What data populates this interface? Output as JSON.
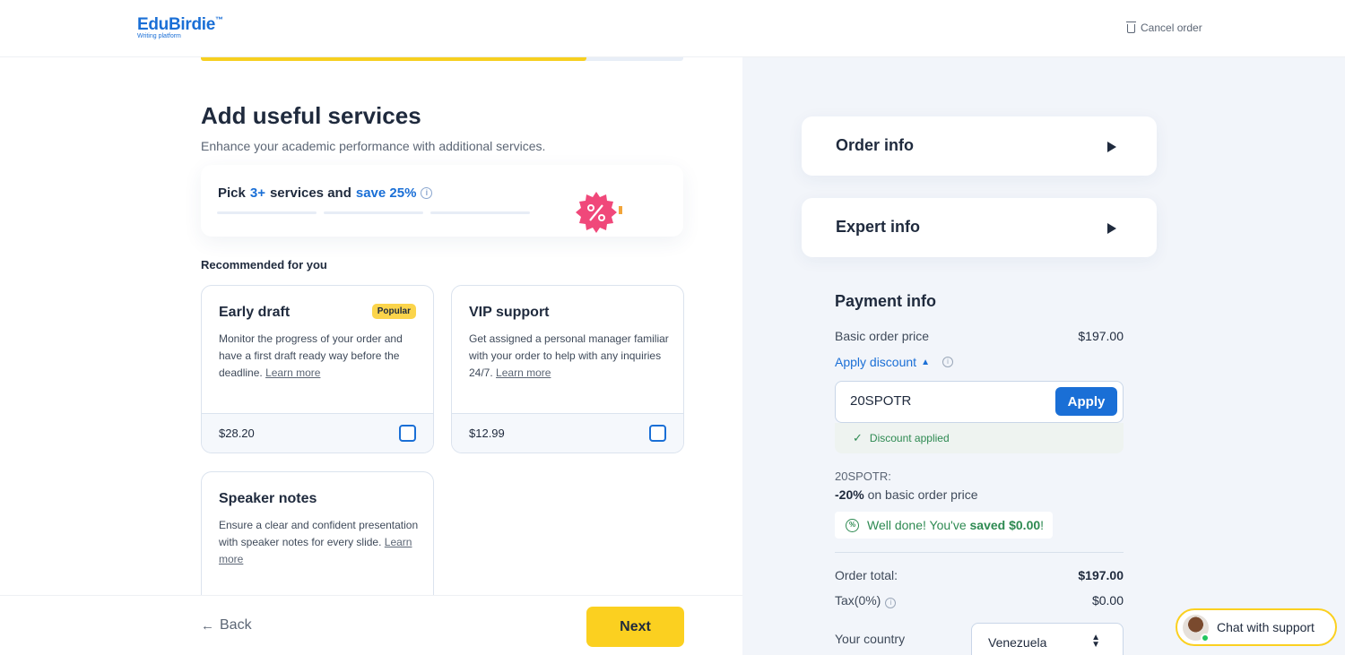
{
  "header": {
    "logo_name": "EduBirdie",
    "logo_tm": "™",
    "logo_tagline": "Writing platform",
    "cancel_label": "Cancel order"
  },
  "progress": {
    "fraction": 0.8
  },
  "main": {
    "title": "Add useful services",
    "subtitle": "Enhance your academic performance with additional services.",
    "promo": {
      "pick": "Pick",
      "count": "3+",
      "services": "services and",
      "save": "save 25%",
      "info_icon": "i"
    },
    "recommended": "Recommended for you",
    "cards": [
      {
        "title": "Early draft",
        "badge": "Popular",
        "desc": "Monitor the progress of your order and have a first draft ready way before the deadline.",
        "link": "Learn more",
        "price": "$28.20",
        "checked": false
      },
      {
        "title": "VIP support",
        "desc": "Get assigned a personal manager familiar with your order to help with any inquiries 24/7.",
        "link": "Learn more",
        "price": "$12.99",
        "checked": false
      },
      {
        "title": "Speaker notes",
        "desc": "Ensure a clear and confident presentation with speaker notes for every slide.",
        "link": "Learn more"
      }
    ]
  },
  "footer": {
    "back_label": "Back",
    "back_arrow": "←",
    "next_label": "Next"
  },
  "sidebar": {
    "order_info": "Order info",
    "expert_info": "Expert info",
    "payment_title": "Payment info",
    "basic_price_label": "Basic order price",
    "basic_price": "$197.00",
    "apply_discount": "Apply discount",
    "discount_code": "20SPOTR",
    "apply_button": "Apply",
    "discount_applied": "Discount applied",
    "code_label": "20SPOTR:",
    "code_percent": "-20%",
    "code_text": "on basic order price",
    "saved_prefix": "Well done! You've",
    "saved_bold": "saved $0.00",
    "saved_suffix": "!",
    "saved_icon": "%",
    "order_total_label": "Order total:",
    "order_total": "$197.00",
    "tax_label": "Tax(0%)",
    "tax": "$0.00",
    "country_label": "Your country",
    "country_value": "Venezuela"
  },
  "chat": {
    "label": "Chat with support"
  },
  "colors": {
    "brand_blue": "#1a6fd6",
    "accent_yellow": "#fbd020",
    "success_green": "#2e8a52",
    "badge_pink": "#f0487a"
  }
}
